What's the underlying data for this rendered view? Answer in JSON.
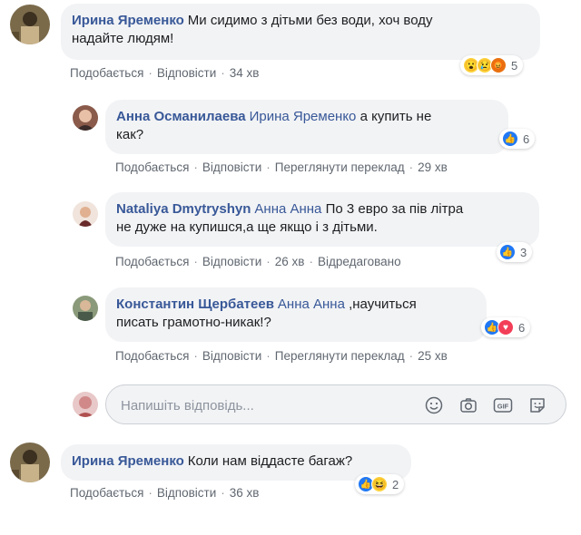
{
  "comments": [
    {
      "author": "Ирина Яременко",
      "mention": "",
      "text": "Ми сидимо з дітьми без води, хоч воду",
      "text2": "надайте людям!",
      "actions": {
        "like": "Подобається",
        "reply": "Відповісти",
        "time": "34 хв"
      },
      "reactions": {
        "icons": [
          "wow-icon",
          "sad-icon",
          "angry-icon"
        ],
        "count": "5"
      }
    },
    {
      "author": "Анна Османилаева",
      "mention": "Ирина Яременко",
      "text": "а купить не",
      "text2": "как?",
      "actions": {
        "like": "Подобається",
        "reply": "Відповісти",
        "translate": "Переглянути переклад",
        "time": "29 хв"
      },
      "reactions": {
        "icons": [
          "like-icon"
        ],
        "count": "6"
      }
    },
    {
      "author": "Nataliya Dmytryshyn",
      "mention": "Анна Анна",
      "text": "По 3 евро за пів літра",
      "text2": "не дуже на купишся,а ще якщо і з дітьми.",
      "actions": {
        "like": "Подобається",
        "reply": "Відповісти",
        "time": "26 хв",
        "edited": "Відредаговано"
      },
      "reactions": {
        "icons": [
          "like-icon"
        ],
        "count": "3"
      }
    },
    {
      "author": "Константин Щербатеев",
      "mention": "Анна Анна",
      "text": ",научиться",
      "text2": "писать грамотно-никак!?",
      "actions": {
        "like": "Подобається",
        "reply": "Відповісти",
        "translate": "Переглянути переклад",
        "time": "25 хв"
      },
      "reactions": {
        "icons": [
          "like-icon",
          "love-icon"
        ],
        "count": "6"
      }
    },
    {
      "author": "Ирина Яременко",
      "mention": "",
      "text": "Коли нам віддасте багаж?",
      "text2": "",
      "actions": {
        "like": "Подобається",
        "reply": "Відповісти",
        "time": "36 хв"
      },
      "reactions": {
        "icons": [
          "like-icon",
          "haha-icon"
        ],
        "count": "2"
      }
    }
  ],
  "reply_box": {
    "placeholder": "Напишіть відповідь...",
    "tools": [
      "emoji-icon",
      "camera-icon",
      "gif-icon",
      "sticker-icon"
    ]
  },
  "colors": {
    "link": "#385898",
    "bubble": "#f2f3f5",
    "like": "#2078f4",
    "love": "#f33e58"
  }
}
